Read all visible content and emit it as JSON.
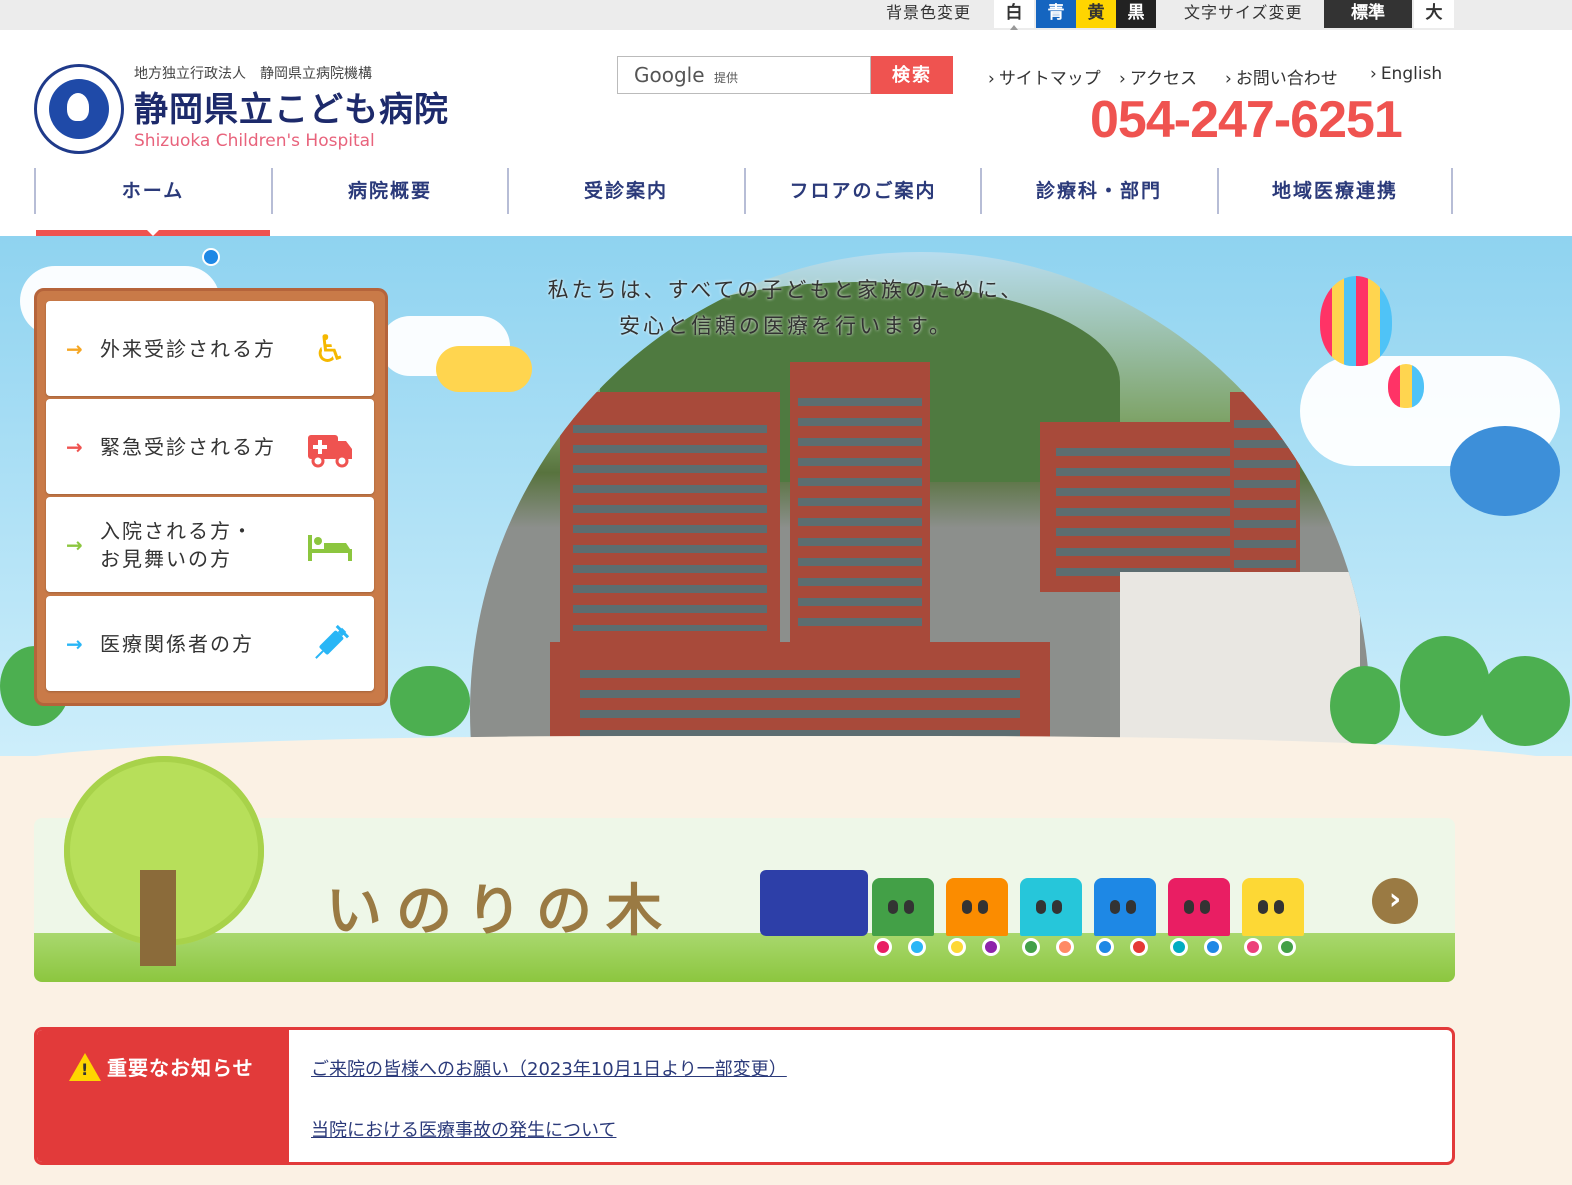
{
  "utility": {
    "bg_label": "背景色変更",
    "bg_options": [
      "白",
      "青",
      "黄",
      "黒"
    ],
    "font_label": "文字サイズ変更",
    "font_options": [
      "標準",
      "大"
    ]
  },
  "header": {
    "org": "地方独立行政法人　静岡県立病院機構",
    "name": "静岡県立こども病院",
    "name_en": "Shizuoka Children's Hospital",
    "search": {
      "google": "Google",
      "provided": "提供",
      "button": "検索"
    },
    "links": [
      "サイトマップ",
      "アクセス",
      "お問い合わせ",
      "English"
    ],
    "phone": "054-247-6251"
  },
  "nav": {
    "items": [
      "ホーム",
      "病院概要",
      "受診案内",
      "フロアのご案内",
      "診療科・部門",
      "地域医療連携"
    ],
    "active_index": 0
  },
  "hero": {
    "tagline_line1": "私たちは、すべての子どもと家族のために、",
    "tagline_line2": "安心と信頼の医療を行います。"
  },
  "menu": {
    "items": [
      {
        "label": "外来受診される方",
        "icon": "wheelchair-icon",
        "arrow_color": "#f5a623",
        "icon_color": "#f5b800"
      },
      {
        "label": "緊急受診される方",
        "icon": "ambulance-icon",
        "arrow_color": "#ef5350",
        "icon_color": "#ef5350"
      },
      {
        "label": "入院される方・\nお見舞いの方",
        "icon": "hospital-bed-icon",
        "arrow_color": "#8cc63f",
        "icon_color": "#8cc63f"
      },
      {
        "label": "医療関係者の方",
        "icon": "syringe-icon",
        "arrow_color": "#29b6f6",
        "icon_color": "#29b6f6"
      }
    ]
  },
  "banner": {
    "title": "いのりの木",
    "arrow": "›"
  },
  "notice": {
    "title": "重要なお知らせ",
    "warn_mark": "!",
    "links": [
      "ご来院の皆様へのお願い（2023年10月1日より一部変更）",
      "当院における医療事故の発生について"
    ]
  }
}
